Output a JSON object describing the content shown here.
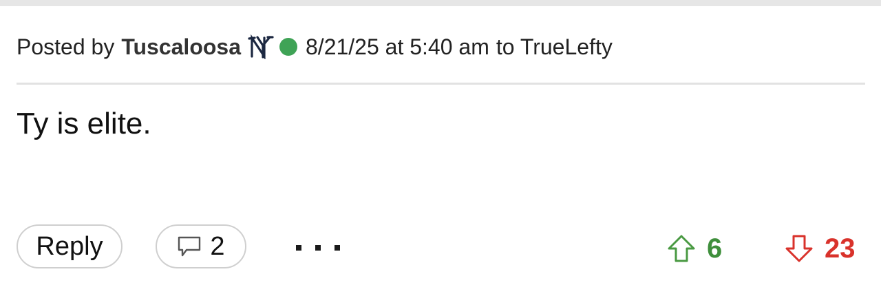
{
  "post": {
    "posted_by_label": "Posted by",
    "author": "Tuscaloosa",
    "team_logo": "ny-yankees-logo",
    "online_status": "online",
    "online_color": "#3fa356",
    "timestamp": "8/21/25 at 5:40 am",
    "reply_to": "to TrueLefty",
    "body": "Ty is elite."
  },
  "actions": {
    "reply_label": "Reply",
    "comment_count": "2",
    "more_icon": "ellipsis-icon",
    "upvotes": "6",
    "downvotes": "23",
    "upvote_color": "#3f8f3c",
    "downvote_color": "#d9322b"
  }
}
